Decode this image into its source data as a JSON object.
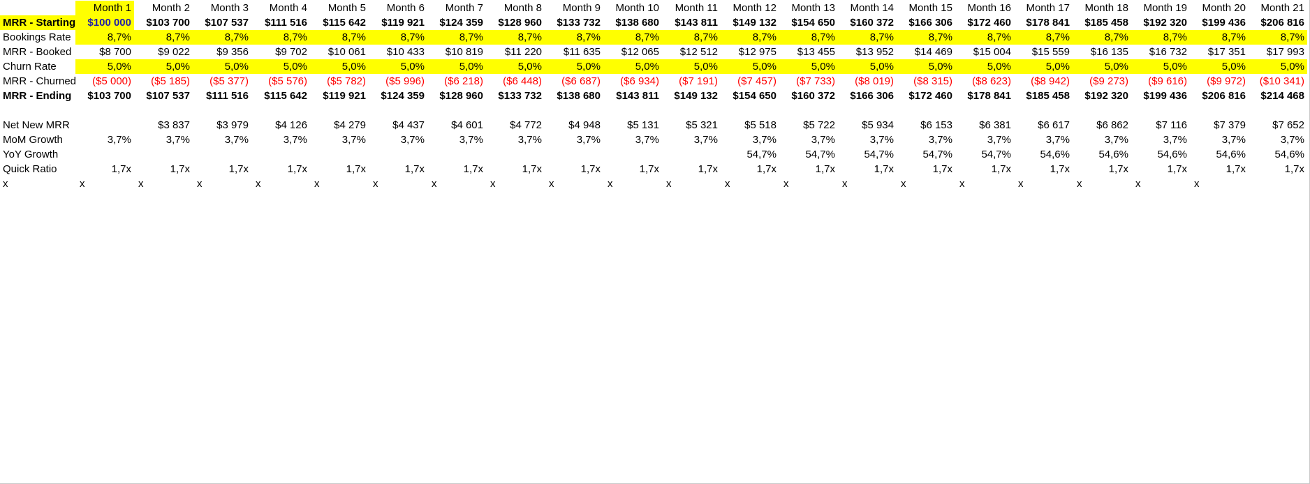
{
  "sheet": {
    "headers": [
      "Month 1",
      "Month 2",
      "Month 3",
      "Month 4",
      "Month 5",
      "Month 6",
      "Month 7",
      "Month 8",
      "Month 9",
      "Month 10",
      "Month 11",
      "Month 12",
      "Month 13",
      "Month 14",
      "Month 15",
      "Month 16",
      "Month 17",
      "Month 18",
      "Month 19",
      "Month 20",
      "Month 21"
    ],
    "rows": [
      {
        "label": "MRR - Starting",
        "bold": true,
        "labelYellow": true,
        "yellow": "first",
        "color": "",
        "values": [
          "$100 000",
          "$103 700",
          "$107 537",
          "$111 516",
          "$115 642",
          "$119 921",
          "$124 359",
          "$128 960",
          "$133 732",
          "$138 680",
          "$143 811",
          "$149 132",
          "$154 650",
          "$160 372",
          "$166 306",
          "$172 460",
          "$178 841",
          "$185 458",
          "$192 320",
          "$199 436",
          "$206 816"
        ]
      },
      {
        "label": "Bookings Rate",
        "bold": false,
        "labelYellow": false,
        "yellow": "values",
        "color": "",
        "values": [
          "8,7%",
          "8,7%",
          "8,7%",
          "8,7%",
          "8,7%",
          "8,7%",
          "8,7%",
          "8,7%",
          "8,7%",
          "8,7%",
          "8,7%",
          "8,7%",
          "8,7%",
          "8,7%",
          "8,7%",
          "8,7%",
          "8,7%",
          "8,7%",
          "8,7%",
          "8,7%",
          "8,7%"
        ]
      },
      {
        "label": "MRR - Booked",
        "bold": false,
        "labelYellow": false,
        "yellow": "none",
        "color": "",
        "values": [
          "$8 700",
          "$9 022",
          "$9 356",
          "$9 702",
          "$10 061",
          "$10 433",
          "$10 819",
          "$11 220",
          "$11 635",
          "$12 065",
          "$12 512",
          "$12 975",
          "$13 455",
          "$13 952",
          "$14 469",
          "$15 004",
          "$15 559",
          "$16 135",
          "$16 732",
          "$17 351",
          "$17 993"
        ]
      },
      {
        "label": "Churn Rate",
        "bold": false,
        "labelYellow": false,
        "yellow": "values",
        "color": "",
        "values": [
          "5,0%",
          "5,0%",
          "5,0%",
          "5,0%",
          "5,0%",
          "5,0%",
          "5,0%",
          "5,0%",
          "5,0%",
          "5,0%",
          "5,0%",
          "5,0%",
          "5,0%",
          "5,0%",
          "5,0%",
          "5,0%",
          "5,0%",
          "5,0%",
          "5,0%",
          "5,0%",
          "5,0%"
        ]
      },
      {
        "label": "MRR - Churned",
        "bold": false,
        "labelYellow": false,
        "yellow": "none",
        "color": "red",
        "values": [
          "($5 000)",
          "($5 185)",
          "($5 377)",
          "($5 576)",
          "($5 782)",
          "($5 996)",
          "($6 218)",
          "($6 448)",
          "($6 687)",
          "($6 934)",
          "($7 191)",
          "($7 457)",
          "($7 733)",
          "($8 019)",
          "($8 315)",
          "($8 623)",
          "($8 942)",
          "($9 273)",
          "($9 616)",
          "($9 972)",
          "($10 341)"
        ]
      },
      {
        "label": "MRR - Ending",
        "bold": true,
        "labelYellow": false,
        "yellow": "none",
        "color": "",
        "values": [
          "$103 700",
          "$107 537",
          "$111 516",
          "$115 642",
          "$119 921",
          "$124 359",
          "$128 960",
          "$133 732",
          "$138 680",
          "$143 811",
          "$149 132",
          "$154 650",
          "$160 372",
          "$166 306",
          "$172 460",
          "$178 841",
          "$185 458",
          "$192 320",
          "$199 436",
          "$206 816",
          "$214 468"
        ]
      },
      {
        "label": "",
        "bold": false,
        "labelYellow": false,
        "yellow": "none",
        "color": "",
        "values": []
      },
      {
        "label": "Net New MRR",
        "bold": false,
        "labelYellow": false,
        "yellow": "none",
        "color": "",
        "values": [
          "",
          "$3 837",
          "$3 979",
          "$4 126",
          "$4 279",
          "$4 437",
          "$4 601",
          "$4 772",
          "$4 948",
          "$5 131",
          "$5 321",
          "$5 518",
          "$5 722",
          "$5 934",
          "$6 153",
          "$6 381",
          "$6 617",
          "$6 862",
          "$7 116",
          "$7 379",
          "$7 652"
        ]
      },
      {
        "label": "MoM Growth",
        "bold": false,
        "labelYellow": false,
        "yellow": "none",
        "color": "",
        "values": [
          "3,7%",
          "3,7%",
          "3,7%",
          "3,7%",
          "3,7%",
          "3,7%",
          "3,7%",
          "3,7%",
          "3,7%",
          "3,7%",
          "3,7%",
          "3,7%",
          "3,7%",
          "3,7%",
          "3,7%",
          "3,7%",
          "3,7%",
          "3,7%",
          "3,7%",
          "3,7%",
          "3,7%"
        ]
      },
      {
        "label": "YoY Growth",
        "bold": false,
        "labelYellow": false,
        "yellow": "none",
        "color": "",
        "values": [
          "",
          "",
          "",
          "",
          "",
          "",
          "",
          "",
          "",
          "",
          "",
          "54,7%",
          "54,7%",
          "54,7%",
          "54,7%",
          "54,7%",
          "54,6%",
          "54,6%",
          "54,6%",
          "54,6%",
          "54,6%"
        ]
      },
      {
        "label": "Quick Ratio",
        "bold": false,
        "labelYellow": false,
        "yellow": "none",
        "color": "",
        "values": [
          "1,7x",
          "1,7x",
          "1,7x",
          "1,7x",
          "1,7x",
          "1,7x",
          "1,7x",
          "1,7x",
          "1,7x",
          "1,7x",
          "1,7x",
          "1,7x",
          "1,7x",
          "1,7x",
          "1,7x",
          "1,7x",
          "1,7x",
          "1,7x",
          "1,7x",
          "1,7x",
          "1,7x"
        ]
      },
      {
        "label": "x",
        "bold": false,
        "labelYellow": false,
        "yellow": "none",
        "color": "",
        "mark": true,
        "values": [
          "x",
          "x",
          "x",
          "x",
          "x",
          "x",
          "x",
          "x",
          "x",
          "x",
          "x",
          "x",
          "x",
          "x",
          "x",
          "x",
          "x",
          "x",
          "x",
          "x",
          ""
        ]
      }
    ]
  },
  "colors": {
    "highlight": "#ffff00",
    "negative": "#ff0000",
    "selected_text": "#1f1fa8"
  }
}
